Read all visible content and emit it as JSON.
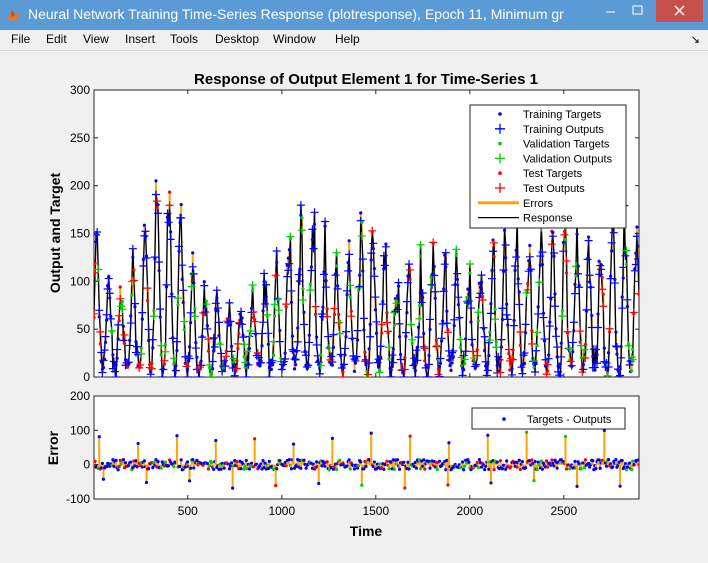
{
  "window": {
    "title": "Neural Network Training Time-Series Response (plotresponse), Epoch 11, Minimum gr",
    "minimize_icon": "minimize-icon",
    "maximize_icon": "maximize-icon",
    "close_icon": "close-icon"
  },
  "menu": {
    "items": [
      "File",
      "Edit",
      "View",
      "Insert",
      "Tools",
      "Desktop",
      "Window",
      "Help"
    ],
    "dock_icon": "dock-arrow-icon"
  },
  "chart_data": [
    {
      "type": "line",
      "title": "Response of Output Element 1 for Time-Series 1",
      "xlabel": "",
      "ylabel": "Output and Target",
      "xlim": [
        1,
        2900
      ],
      "ylim": [
        0,
        300
      ],
      "yticks": [
        0,
        50,
        100,
        150,
        200,
        250,
        300
      ],
      "yticklabels": [
        "0",
        "50",
        "100",
        "150",
        "200",
        "250",
        "300"
      ],
      "legend_position": "top-right",
      "legend": [
        {
          "name": "Training Targets",
          "color": "#0000ff",
          "marker": "dot"
        },
        {
          "name": "Training Outputs",
          "color": "#0000ff",
          "marker": "plus"
        },
        {
          "name": "Validation Targets",
          "color": "#00cc00",
          "marker": "dot"
        },
        {
          "name": "Validation Outputs",
          "color": "#00cc00",
          "marker": "plus"
        },
        {
          "name": "Test Targets",
          "color": "#ff0000",
          "marker": "dot"
        },
        {
          "name": "Test Outputs",
          "color": "#ff0000",
          "marker": "plus"
        },
        {
          "name": "Errors",
          "color": "#ffa500",
          "marker": "line"
        },
        {
          "name": "Response",
          "color": "#000000",
          "marker": "line"
        }
      ],
      "envelope_peaks": [
        {
          "x": 10,
          "y": 160
        },
        {
          "x": 120,
          "y": 95
        },
        {
          "x": 250,
          "y": 160
        },
        {
          "x": 350,
          "y": 240
        },
        {
          "x": 470,
          "y": 175
        },
        {
          "x": 620,
          "y": 80
        },
        {
          "x": 800,
          "y": 70
        },
        {
          "x": 960,
          "y": 110
        },
        {
          "x": 1050,
          "y": 205
        },
        {
          "x": 1180,
          "y": 200
        },
        {
          "x": 1300,
          "y": 120
        },
        {
          "x": 1460,
          "y": 185
        },
        {
          "x": 1630,
          "y": 110
        },
        {
          "x": 1800,
          "y": 140
        },
        {
          "x": 1990,
          "y": 120
        },
        {
          "x": 2170,
          "y": 150
        },
        {
          "x": 2330,
          "y": 160
        },
        {
          "x": 2500,
          "y": 165
        },
        {
          "x": 2650,
          "y": 155
        },
        {
          "x": 2860,
          "y": 190
        }
      ]
    },
    {
      "type": "line",
      "title": "",
      "xlabel": "Time",
      "ylabel": "Error",
      "xlim": [
        1,
        2900
      ],
      "ylim": [
        -100,
        200
      ],
      "yticks": [
        -100,
        0,
        100,
        200
      ],
      "yticklabels": [
        "-100",
        "0",
        "100",
        "200"
      ],
      "xticks": [
        500,
        1000,
        1500,
        2000,
        2500
      ],
      "xticklabels": [
        "500",
        "1000",
        "1500",
        "2000",
        "2500"
      ],
      "legend_position": "top-right",
      "legend": [
        {
          "name": "Targets - Outputs",
          "color": "#0000ff",
          "marker": "dot"
        }
      ],
      "error_range": [
        -70,
        100
      ]
    }
  ]
}
